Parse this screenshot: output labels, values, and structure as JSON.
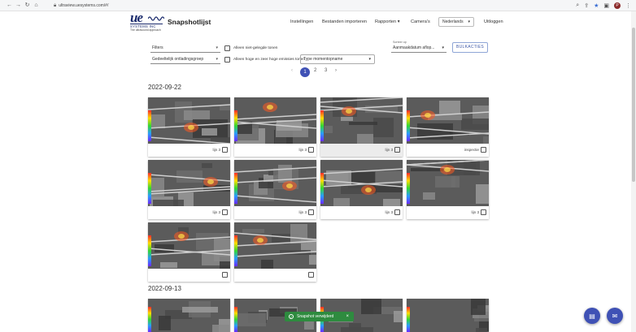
{
  "browser": {
    "url": "ultraview.uesystems.com/#/",
    "profile_initial": "P"
  },
  "header": {
    "logo_text": "ue",
    "logo_systems": "SYSTEMS INC",
    "logo_tagline": "The ultrasound approach",
    "title": "Snapshotlijst",
    "nav": {
      "settings": "Instellingen",
      "import": "Bestanden importeren",
      "reports": "Rapporten",
      "cameras": "Camera's",
      "language": "Nederlands",
      "logout": "Uitloggen"
    }
  },
  "filters": {
    "filters_select": "Filters",
    "shared_group": "Gedeeltelijk ontladingsgroep",
    "only_unshared": "Alleen niet-gelegde tonen",
    "only_high_low": "Alleen hoge en zeer hoge emissies tonen",
    "moment_type": "Type momentopname",
    "sort_label": "Sorteer op",
    "sort_value": "Aanmaakdatum aflop...",
    "bulk_button": "BULKACTIES"
  },
  "pagination": {
    "prev": "‹",
    "pages": [
      "1",
      "2",
      "3"
    ],
    "active": "1",
    "next": "›"
  },
  "groups": [
    {
      "date": "2022-09-22",
      "cards": [
        {
          "label": "lijn 3",
          "selected": false
        },
        {
          "label": "lijn 3",
          "selected": false
        },
        {
          "label": "lijn 3",
          "selected": true
        },
        {
          "label": "inspectie",
          "selected": false
        },
        {
          "label": "lijn 3",
          "selected": false
        },
        {
          "label": "lijn 3",
          "selected": false
        },
        {
          "label": "lijn 3",
          "selected": false
        },
        {
          "label": "lijn 3",
          "selected": false
        },
        {
          "label": "",
          "selected": false
        },
        {
          "label": "",
          "selected": false
        }
      ]
    },
    {
      "date": "2022-09-13",
      "cards": []
    }
  ],
  "toast": {
    "message": "Snapshot verwijderd",
    "close": "×"
  },
  "icons": {
    "back": "back-icon",
    "forward": "forward-icon",
    "reload": "reload-icon",
    "home": "home-icon",
    "fab_one": "document-icon",
    "fab_two": "chat-icon"
  },
  "colors": {
    "primary": "#3f51b5",
    "toast": "#2e8b3f",
    "brand": "#1a2a6c"
  }
}
